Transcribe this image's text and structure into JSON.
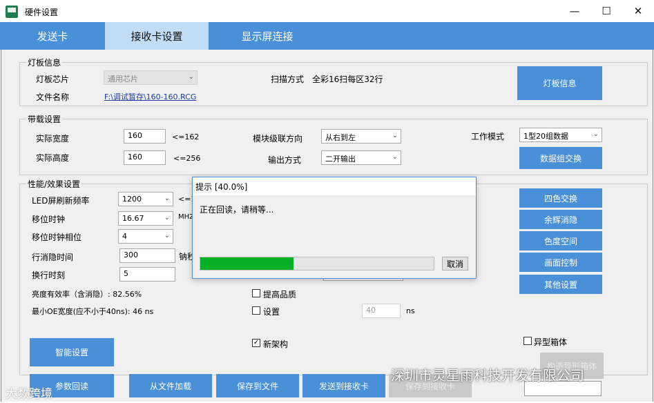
{
  "window": {
    "title": "硬件设置",
    "minimize": "—",
    "maximize": "☐",
    "close": "✕"
  },
  "tabs": [
    {
      "label": "发送卡"
    },
    {
      "label": "接收卡设置"
    },
    {
      "label": "显示屏连接"
    }
  ],
  "panel_info": {
    "title": "灯板信息",
    "chip_label": "灯板芯片",
    "chip_value": "通用芯片",
    "file_label": "文件名称",
    "file_value": "F:\\调试暂存\\160-160.RCG",
    "scan_label": "扫描方式",
    "scan_value": "全彩16扫每区32行",
    "button": "灯板信息"
  },
  "panel_load": {
    "title": "带载设置",
    "width_label": "实际宽度",
    "width_value": "160",
    "width_hint": "<=162",
    "height_label": "实际高度",
    "height_value": "160",
    "height_hint": "<=256",
    "cascade_label": "模块级联方向",
    "cascade_value": "从右到左",
    "output_label": "输出方式",
    "output_value": "二开输出",
    "mode_label": "工作模式",
    "mode_value": "1型20组数据",
    "button": "数据组交换"
  },
  "panel_perf": {
    "title": "性能/效果设置",
    "refresh_label": "LED屏刷新频率",
    "refresh_value": "1200",
    "refresh_hint": "<=1",
    "shift_clock_label": "移位时钟",
    "shift_clock_value": "16.67",
    "shift_clock_unit": "MHZ",
    "phase_label": "移位时钟相位",
    "phase_value": "4",
    "blank_label": "行消隐时间",
    "blank_value": "300",
    "blank_unit": "钠秒",
    "line_change_label": "换行时刻",
    "line_change_value": "5",
    "brightness_text": "亮度有效率（含消隐）: 82.56%",
    "min_oe_text": "最小OE宽度(应不小于40ns): 46 ns",
    "improve_quality": "提高品质",
    "setting": "设置",
    "setting_value": "40",
    "setting_unit": "ns",
    "side_buttons": [
      "四色交换",
      "余辉消隐",
      "色度空间",
      "画面控制",
      "其他设置"
    ]
  },
  "bottom": {
    "new_arch": "新架构",
    "odd_box": "异型箱体",
    "smart_btn": "智能设置",
    "readback_btn": "参数回读",
    "load_btn": "从文件加载",
    "save_btn": "保存到文件",
    "send_btn": "发送到接收卡",
    "save_card_btn": "保存到接收卡",
    "odd_btn": "构造异形箱体"
  },
  "dialog": {
    "title": "提示 [40.0%]",
    "message": "正在回读，请稍等...",
    "progress": 0.4,
    "cancel": "取消"
  },
  "watermarks": {
    "left": "大数跨境",
    "right": "深圳市灵星雨科技开发有限公司"
  },
  "colors": {
    "accent": "#4a90d9",
    "tab_active": "#c0ddf5",
    "progress": "#06b025",
    "panel_bg": "#f0f0f0"
  }
}
